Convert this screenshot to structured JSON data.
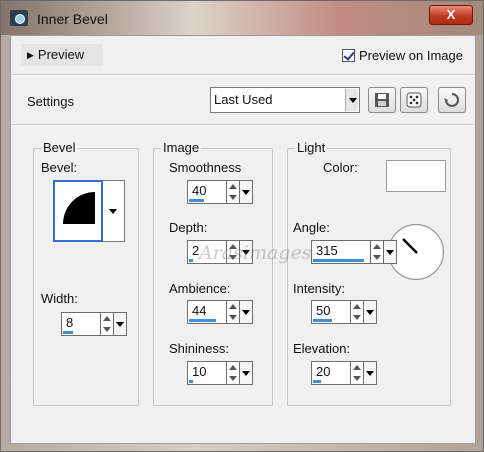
{
  "window": {
    "title": "Inner Bevel",
    "close_label": "X"
  },
  "preview": {
    "toggle_label": "Preview",
    "preview_on_image_label": "Preview on Image",
    "preview_on_image_checked": true
  },
  "settings": {
    "label": "Settings",
    "selected": "Last Used"
  },
  "bevel_group": {
    "title": "Bevel",
    "bevel_label": "Bevel:",
    "width_label": "Width:",
    "width_value": "8",
    "width_fill": 0.25
  },
  "image_group": {
    "title": "Image",
    "fields": [
      {
        "label": "Smoothness",
        "value": "40",
        "fill": 0.4
      },
      {
        "label": "Depth:",
        "value": "2",
        "fill": 0.1
      },
      {
        "label": "Ambience:",
        "value": "44",
        "fill": 0.72
      },
      {
        "label": "Shininess:",
        "value": "10",
        "fill": 0.1
      }
    ]
  },
  "light_group": {
    "title": "Light",
    "color_label": "Color:",
    "color_value": "#ffffff",
    "fields": [
      {
        "label": "Angle:",
        "value": "315",
        "fill": 0.88
      },
      {
        "label": "Intensity:",
        "value": "50",
        "fill": 0.5
      },
      {
        "label": "Elevation:",
        "value": "20",
        "fill": 0.22
      }
    ]
  },
  "icons": {
    "save": "save-icon",
    "randomize": "dice-icon",
    "reset": "reset-icon"
  },
  "watermark_text": "Arasimages"
}
